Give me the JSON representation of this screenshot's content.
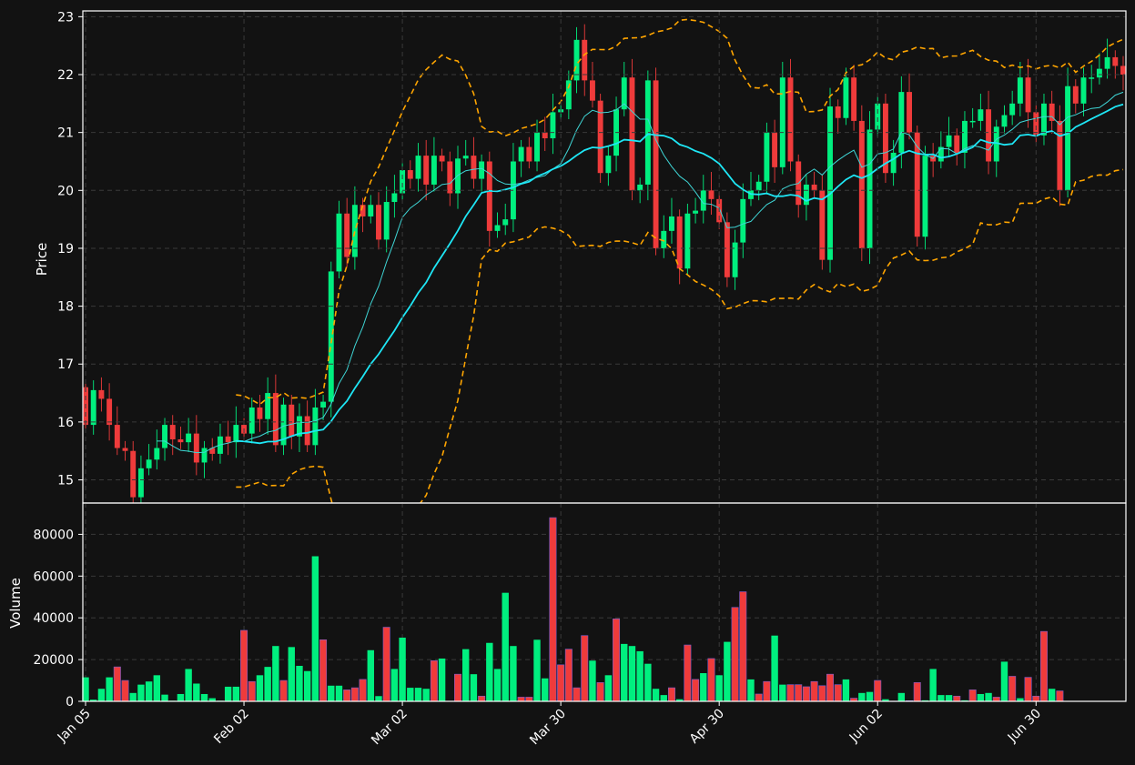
{
  "colors": {
    "background": "#121212",
    "up": "#00ef7f",
    "down": "#ef3b3b",
    "ma_short": "#3fd6d6",
    "ma_long": "#1ee6f5",
    "bands": "#ffa500",
    "grid": "#3a3a3a",
    "text": "#ffffff"
  },
  "chart_data": [
    {
      "type": "candlestick",
      "ylabel": "Price",
      "ylim": [
        14.6,
        23.1
      ],
      "yticks": [
        15,
        16,
        17,
        18,
        19,
        20,
        21,
        22,
        23
      ],
      "xticks": [
        "Jan 05",
        "Feb 02",
        "Mar 02",
        "Mar 30",
        "Apr 30",
        "Jun 02",
        "Jun 30"
      ],
      "xtick_index": [
        0,
        20,
        40,
        60,
        80,
        100,
        120
      ],
      "grid": true,
      "series_ma_short": "thin cyan moving average",
      "series_ma_long": "thick cyan moving average",
      "series_bands": "orange dashed upper/lower bands",
      "close": [
        15.95,
        16.55,
        16.4,
        15.95,
        15.55,
        15.5,
        14.7,
        15.2,
        15.35,
        15.55,
        15.95,
        15.7,
        15.65,
        15.8,
        15.3,
        15.55,
        15.45,
        15.75,
        15.65,
        15.95,
        15.8,
        16.25,
        16.05,
        16.5,
        15.6,
        16.3,
        15.75,
        16.1,
        15.6,
        16.25,
        16.35,
        18.6,
        19.6,
        18.85,
        19.75,
        19.55,
        19.75,
        19.15,
        19.8,
        19.95,
        20.35,
        20.2,
        20.6,
        20.1,
        20.6,
        20.5,
        19.95,
        20.55,
        20.6,
        20.2,
        20.5,
        19.3,
        19.4,
        19.5,
        20.5,
        20.75,
        20.5,
        21.0,
        20.9,
        21.35,
        21.4,
        21.9,
        22.6,
        21.9,
        21.55,
        20.3,
        20.6,
        21.4,
        21.95,
        20.0,
        20.1,
        21.9,
        19.0,
        19.3,
        19.55,
        18.65,
        19.6,
        19.65,
        20.0,
        19.85,
        19.45,
        18.5,
        19.1,
        19.85,
        20.0,
        20.15,
        21.0,
        20.4,
        21.95,
        20.5,
        19.75,
        20.1,
        20.0,
        18.8,
        21.45,
        21.25,
        21.95,
        21.2,
        19.0,
        21.05,
        21.5,
        20.3,
        20.65,
        21.7,
        21.0,
        19.2,
        20.6,
        20.5,
        20.75,
        20.95,
        20.65,
        21.2,
        21.2,
        21.4,
        20.5,
        21.1,
        21.3,
        21.5,
        21.95,
        21.35,
        20.95,
        21.5,
        21.2,
        20.0,
        21.8,
        21.5,
        21.95,
        21.95,
        22.1,
        22.3,
        22.15,
        22.0
      ]
    },
    {
      "type": "bar",
      "ylabel": "Volume",
      "ylim": [
        0,
        95000
      ],
      "yticks": [
        0,
        20000,
        40000,
        60000,
        80000
      ],
      "grid": true,
      "values": [
        11500,
        800,
        6000,
        11500,
        16500,
        10000,
        4000,
        8000,
        9500,
        12500,
        3200,
        300,
        3500,
        15500,
        8500,
        3500,
        1500,
        300,
        7000,
        7000,
        34000,
        9500,
        12500,
        16500,
        26500,
        10000,
        26000,
        17000,
        14500,
        69500,
        29500,
        7500,
        7500,
        5500,
        6500,
        10500,
        24500,
        2500,
        35500,
        15500,
        30500,
        6500,
        6500,
        6000,
        19500,
        20500,
        200,
        13000,
        25000,
        13000,
        2500,
        28000,
        15500,
        52000,
        26500,
        2000,
        2000,
        29500,
        11000,
        88000,
        17500,
        25000,
        6500,
        31500,
        19500,
        9000,
        12500,
        39500,
        27500,
        26500,
        24000,
        18000,
        6000,
        3000,
        6500,
        1000,
        27000,
        10500,
        13500,
        20500,
        12500,
        28500,
        45000,
        52500,
        10500,
        3500,
        9500,
        31500,
        8000,
        8000,
        8000,
        7000,
        9500,
        7500,
        13000,
        8000,
        10500,
        1500,
        4000,
        4500,
        10000,
        1000,
        100,
        4000,
        300,
        9000,
        500,
        15500,
        3000,
        3000,
        2500,
        500,
        5500,
        3500,
        4000,
        2000,
        19000,
        12000,
        1500,
        11500,
        2500,
        33500,
        6000,
        5000
      ],
      "up": [
        1,
        1,
        1,
        1,
        0,
        0,
        1,
        1,
        1,
        1,
        1,
        1,
        1,
        1,
        1,
        1,
        1,
        1,
        1,
        1,
        0,
        0,
        1,
        1,
        1,
        0,
        1,
        1,
        1,
        1,
        0,
        1,
        1,
        0,
        0,
        0,
        1,
        1,
        0,
        1,
        1,
        1,
        1,
        1,
        0,
        1,
        1,
        0,
        1,
        1,
        0,
        1,
        1,
        1,
        1,
        0,
        0,
        1,
        1,
        0,
        0,
        0,
        0,
        0,
        1,
        0,
        1,
        0,
        1,
        1,
        1,
        1,
        1,
        1,
        0,
        1,
        0,
        0,
        1,
        0,
        1,
        1,
        0,
        0,
        1,
        0,
        0,
        1,
        1,
        0,
        0,
        0,
        0,
        0,
        0,
        0,
        1,
        0,
        1,
        1,
        0,
        1,
        0,
        1,
        0,
        0,
        1,
        1,
        1,
        1,
        0,
        1,
        0,
        1,
        1,
        0,
        1,
        0,
        1,
        0,
        0,
        0,
        1
      ]
    }
  ]
}
